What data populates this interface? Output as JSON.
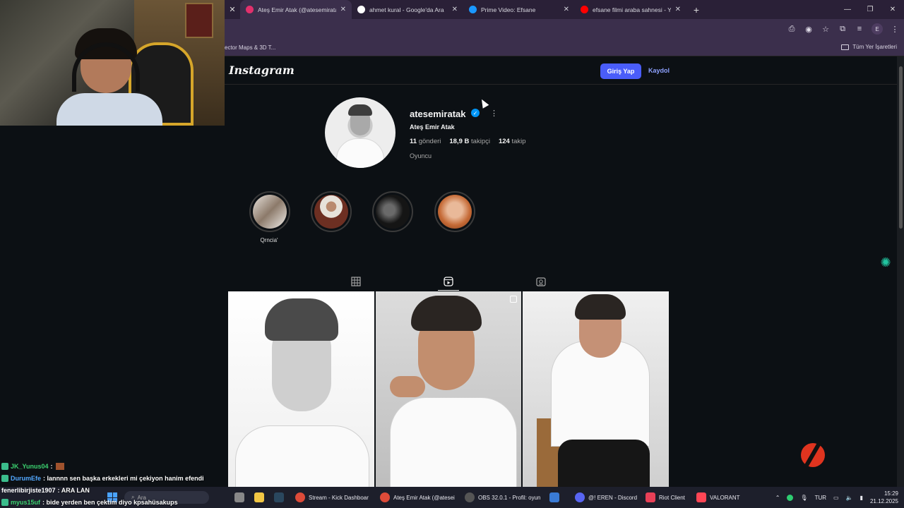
{
  "browser": {
    "tabs": [
      {
        "title": "Ateş Emir Atak (@atesemiratak)",
        "favicon_color": "#e1306c",
        "active": true
      },
      {
        "title": "ahmet kural - Google'da Ara",
        "favicon_color": "#ffffff",
        "active": false
      },
      {
        "title": "Prime Video: Efsane",
        "favicon_color": "#1a98ff",
        "active": false
      },
      {
        "title": "efsane filmi araba sahnesi - You",
        "favicon_color": "#ff0000",
        "active": false
      }
    ],
    "bookmark_left": "ector Maps & 3D T...",
    "bookmark_right": "Tüm Yer İşaretleri",
    "profile_initial": "E"
  },
  "instagram": {
    "logo": "Instagram",
    "login_label": "Giriş Yap",
    "signup_label": "Kaydol",
    "username": "atesemiratak",
    "full_name": "Ateş Emir Atak",
    "posts_count": "11",
    "posts_label": "gönderi",
    "followers_count": "18,9 B",
    "followers_label": "takipçi",
    "following_count": "124",
    "following_label": "takip",
    "bio": "Oyuncu",
    "highlight_label": "Qrncia'",
    "colors": {
      "button": "#4a5df9",
      "link": "#8ea2ff",
      "verified": "#0095f6"
    }
  },
  "chat": [
    {
      "user": "JK_Yunus04",
      "msg": ":",
      "color": "#3bd16f"
    },
    {
      "user": "DurumEfe",
      "msg": ": lannnn sen başka erkekleri mi çekiyon hanim efendi",
      "color": "#52a8ff"
    },
    {
      "user": "fenerlibirjiste1907",
      "msg": ": ARA LAN",
      "color": "#ffffff"
    },
    {
      "user": "myus15uf",
      "msg": ": bide yerden ben çektim diyo kpsahüsakups",
      "color": "#3bd16f"
    }
  ],
  "taskbar": {
    "search_placeholder": "Ara",
    "apps": [
      {
        "label": "Stream - Kick Dashboar",
        "color": "#dd4b39"
      },
      {
        "label": "Ateş Emir Atak (@atesei",
        "color": "#dd4b39"
      },
      {
        "label": "OBS 32.0.1 - Profil: oyun",
        "color": "#555555"
      },
      {
        "label": "@! EREN - Discord",
        "color": "#5865f2"
      },
      {
        "label": "Riot Client",
        "color": "#e84057"
      },
      {
        "label": "VALORANT",
        "color": "#ff4655"
      }
    ],
    "lang": "TUR",
    "time": "15:29",
    "date": "21.12.2025"
  }
}
